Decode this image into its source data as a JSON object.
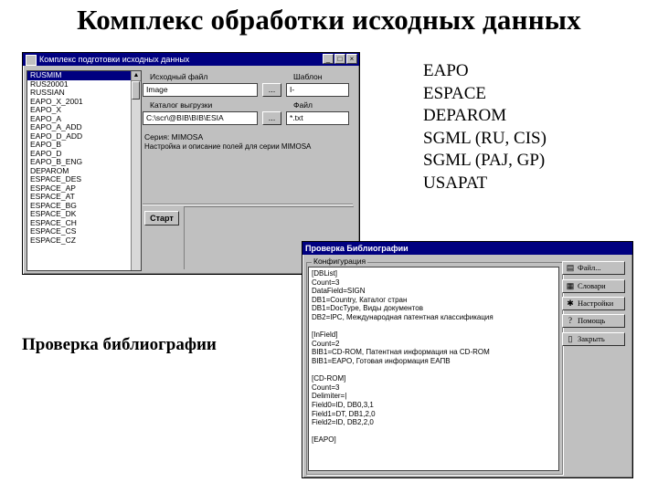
{
  "slide": {
    "title": "Комплекс обработки исходных данных",
    "caption": "Проверка библиографии",
    "formats": [
      "EAPO",
      "ESPACE",
      "DEPAROM",
      "SGML (RU, CIS)",
      "SGML (PAJ, GP)",
      "USAPAT"
    ]
  },
  "win1": {
    "title": "Комплекс подготовки исходных данных",
    "titlebar_color": "#000080",
    "list_items": [
      "RUSMIM",
      "RUS20001",
      "RUSSIAN",
      "EAPO_X_2001",
      "EAPO_X",
      "EAPO_A",
      "EAPO_A_ADD",
      "EAPO_D_ADD",
      "EAPO_B",
      "EAPO_D",
      "EAPO_B_ENG",
      "DEPAROM",
      "ESPACE_DES",
      "ESPACE_AP",
      "ESPACE_AT",
      "ESPACE_BG",
      "ESPACE_DK",
      "ESPACE_CH",
      "ESPACE_CS",
      "ESPACE_CZ"
    ],
    "selected_item": "RUSMIM",
    "source_file_label": "Исходный файл",
    "source_file_value": "Image",
    "browse_label": "...",
    "template_label": "Шаблон",
    "template_value": "I-",
    "output_dir_label": "Каталог выгрузки",
    "output_dir_value": "C:\\scr\\@BIB\\BIB\\ESIA",
    "output_file_label": "Файл",
    "output_file_value": "*.txt",
    "info_line1": "Серия: MIMOSA",
    "info_line2": "Настройка и описание полей для серии MIMOSA",
    "start_label": "Старт"
  },
  "win2": {
    "title": "Проверка Библиографии",
    "titlebar_color": "#000080",
    "group_label": "Конфигурация",
    "lines": [
      "[DBList]",
      "Count=3",
      "DataField=SIGN",
      "DB1=Country, Каталог стран",
      "DB1=DocType, Виды документов",
      "DB2=IPC, Международная патентная классификация",
      "",
      "[InField]",
      "Count=2",
      "BIB1=CD-ROM, Патентная информация на CD-ROM",
      "BIB1=EAPO, Готовая информация ЕАПВ",
      "",
      "[CD-ROM]",
      "Count=3",
      "Delimiter=|",
      "Field0=ID, DB0,3,1",
      "Field1=DT, DB1,2,0",
      "Field2=ID, DB2,2,0",
      "",
      "[EAPO]"
    ],
    "buttons": [
      {
        "label": "Файл...",
        "icon": "folder-icon",
        "glyph": "▤"
      },
      {
        "label": "Словари",
        "icon": "dictionary-icon",
        "glyph": "▦"
      },
      {
        "label": "Настройки",
        "icon": "settings-icon",
        "glyph": "✱"
      },
      {
        "label": "Помощь",
        "icon": "help-icon",
        "glyph": "?"
      },
      {
        "label": "Закрыть",
        "icon": "door-icon",
        "glyph": "▯"
      }
    ]
  }
}
